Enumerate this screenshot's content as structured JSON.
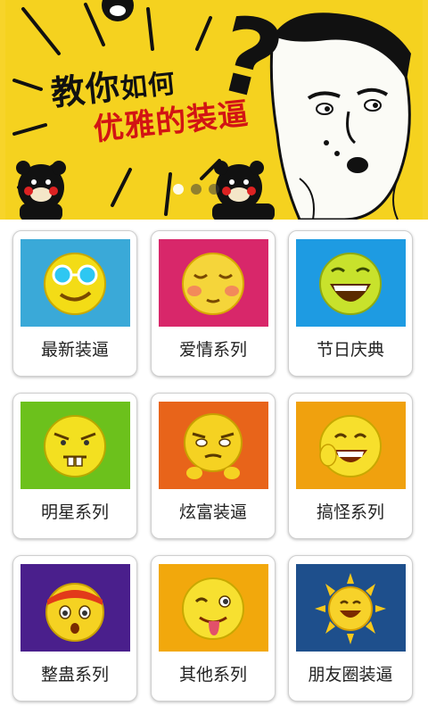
{
  "banner": {
    "title_line1_big": "教你",
    "title_line1_small": "如何",
    "title_line2": "优雅的装逼",
    "question_mark": "?",
    "pager": {
      "count": 3,
      "active": 0
    }
  },
  "categories": [
    {
      "label": "最新装逼",
      "icon": "cool-sunglasses-emoji-icon",
      "bg": "#3aa9d8"
    },
    {
      "label": "爱情系列",
      "icon": "blushing-emoji-icon",
      "bg": "#d8276a"
    },
    {
      "label": "节日庆典",
      "icon": "laughing-emoji-icon",
      "bg": "#1e9be2"
    },
    {
      "label": "明星系列",
      "icon": "buck-teeth-emoji-icon",
      "bg": "#6cc11c"
    },
    {
      "label": "炫富装逼",
      "icon": "smug-emoji-icon",
      "bg": "#e8641a"
    },
    {
      "label": "搞怪系列",
      "icon": "grinning-emoji-icon",
      "bg": "#f0a10e"
    },
    {
      "label": "整蛊系列",
      "icon": "bandana-surprised-emoji-icon",
      "bg": "#4a1f8c"
    },
    {
      "label": "其他系列",
      "icon": "winking-tongue-emoji-icon",
      "bg": "#f2a80c"
    },
    {
      "label": "朋友圈装逼",
      "icon": "sun-laughing-emoji-icon",
      "bg": "#1e4f8c"
    }
  ]
}
